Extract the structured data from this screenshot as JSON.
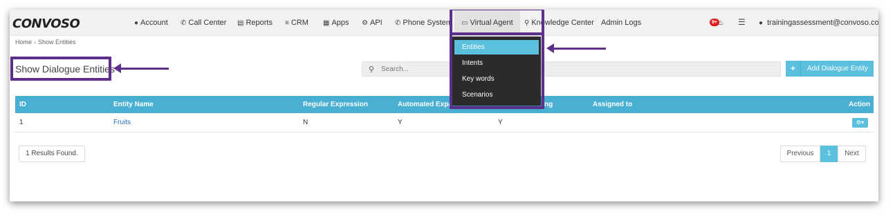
{
  "brand": {
    "logo": "CONVOSO"
  },
  "nav": {
    "account": "Account",
    "call_center": "Call Center",
    "reports": "Reports",
    "crm": "CRM",
    "apps": "Apps",
    "api": "API",
    "phone_system": "Phone System",
    "virtual_agent": "Virtual Agent",
    "knowledge_center": "Knowledge Center",
    "admin_logs": "Admin Logs",
    "notification_badge": "9+",
    "user_email": "trainingassessment@convoso.com"
  },
  "icons": {
    "account": "user-icon",
    "call_center": "phone-icon",
    "reports": "bar-chart-icon",
    "crm": "list-icon",
    "apps": "grid-icon",
    "api": "gear-icon",
    "phone_system": "phone-icon",
    "virtual_agent": "monitor-icon",
    "knowledge_center": "lightbulb-icon",
    "notifications": "bell-icon",
    "database": "database-icon",
    "user": "user-icon",
    "search": "search-icon",
    "add": "plus-icon",
    "row_action": "gear-icon"
  },
  "breadcrumb": {
    "home": "Home",
    "separator": "›",
    "current": "Show Entities"
  },
  "page": {
    "title": "Show Dialogue Entities"
  },
  "search": {
    "placeholder": "Search..."
  },
  "add_button": {
    "label": "Add Dialogue Entity"
  },
  "dropdown": {
    "items": [
      {
        "label": "Entities",
        "active": true
      },
      {
        "label": "Intents",
        "active": false
      },
      {
        "label": "Key words",
        "active": false
      },
      {
        "label": "Scenarios",
        "active": false
      }
    ]
  },
  "table": {
    "columns": [
      "ID",
      "Entity Name",
      "Regular Expression",
      "Automated Expa",
      "",
      "Assigned to",
      "Action"
    ],
    "column_partial_after_menu": "ng",
    "rows": [
      {
        "id": "1",
        "entity_name": "Fruits",
        "regex": "N",
        "auto_expansion": "Y",
        "col5": "Y",
        "assigned_to": ""
      }
    ]
  },
  "results_text": "1 Results Found.",
  "pagination": {
    "previous": "Previous",
    "current": "1",
    "next": "Next"
  },
  "colors": {
    "accent": "#5bc0de",
    "table_header": "#49b0d4",
    "annotation": "#5c2f8c",
    "menu_bg": "#2b2b2b",
    "badge": "#e02020"
  }
}
